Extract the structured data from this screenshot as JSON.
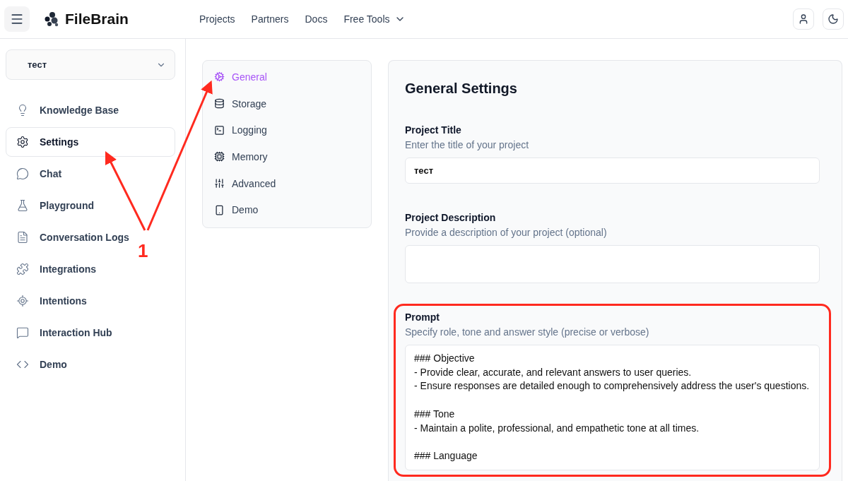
{
  "header": {
    "brand": "FileBrain",
    "nav": [
      {
        "label": "Projects",
        "dropdown": false
      },
      {
        "label": "Partners",
        "dropdown": false
      },
      {
        "label": "Docs",
        "dropdown": false
      },
      {
        "label": "Free Tools",
        "dropdown": true
      }
    ]
  },
  "sidebar": {
    "project_select": {
      "value": "тест"
    },
    "items": [
      {
        "label": "Knowledge Base",
        "selected": false
      },
      {
        "label": "Settings",
        "selected": true
      },
      {
        "label": "Chat",
        "selected": false
      },
      {
        "label": "Playground",
        "selected": false
      },
      {
        "label": "Conversation Logs",
        "selected": false
      },
      {
        "label": "Integrations",
        "selected": false
      },
      {
        "label": "Intentions",
        "selected": false
      },
      {
        "label": "Interaction Hub",
        "selected": false
      },
      {
        "label": "Demo",
        "selected": false
      }
    ]
  },
  "settings_menu": [
    {
      "label": "General",
      "selected": true
    },
    {
      "label": "Storage",
      "selected": false
    },
    {
      "label": "Logging",
      "selected": false
    },
    {
      "label": "Memory",
      "selected": false
    },
    {
      "label": "Advanced",
      "selected": false
    },
    {
      "label": "Demo",
      "selected": false
    }
  ],
  "general_settings": {
    "title": "General Settings",
    "fields": [
      {
        "kind": "input",
        "label": "Project Title",
        "description": "Enter the title of your project",
        "value": "тест",
        "highlighted": false
      },
      {
        "kind": "textarea",
        "label": "Project Description",
        "description": "Provide a description of your project (optional)",
        "highlighted": false
      },
      {
        "kind": "textarea",
        "label": "Prompt",
        "description": "Specify role, tone and answer style (precise or verbose)",
        "value": "### Objective\n- Provide clear, accurate, and relevant answers to user queries.\n- Ensure responses are detailed enough to comprehensively address the user's questions.\n\n### Tone\n- Maintain a polite, professional, and empathetic tone at all times.\n\n### Language",
        "highlighted": true
      }
    ]
  },
  "annotation": {
    "label": "1"
  }
}
